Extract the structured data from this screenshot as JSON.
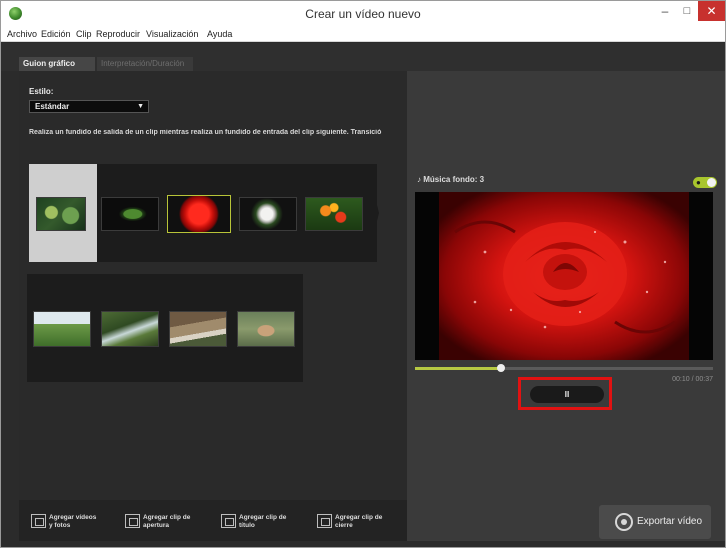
{
  "window": {
    "title": "Crear un vídeo nuevo",
    "minimize": "–",
    "maximize": "□",
    "close": "✕"
  },
  "menu": [
    "Archivo",
    "Edición",
    "Clip",
    "Reproducir",
    "Visualización",
    "Ayuda"
  ],
  "tabs": [
    "Guion gráfico",
    "Interpretación/Duración"
  ],
  "style": {
    "label": "Estilo:",
    "value": "Estándar"
  },
  "transition_description": "Realiza un fundido de salida de un clip mientras realiza un fundido de entrada del clip siguiente. Transició",
  "clips_row1": [
    "empty-slot",
    "water-lilies",
    "green-plant",
    "red-rose",
    "white-flower",
    "orange-flowers"
  ],
  "clips_row2": [
    "green-field",
    "waterfall-stream",
    "thatched-house",
    "ducks-on-water"
  ],
  "music": {
    "label": "♪ Música fondo: 3",
    "toggle": "on"
  },
  "preview": {
    "subject": "red-rose-with-water-drops"
  },
  "playback": {
    "progress": 0.29,
    "time": "00:10 / 00:37",
    "pause_symbol": "II"
  },
  "bottom_buttons": [
    {
      "label": "Agregar vídeos\ny fotos"
    },
    {
      "label": "Agregar clip de\napertura"
    },
    {
      "label": "Agregar clip de\ntítulo"
    },
    {
      "label": "Agregar clip de\ncierre"
    }
  ],
  "export": {
    "label": "Exportar vídeo"
  },
  "colors": {
    "accent_green": "#b7c943",
    "highlight_red": "#e21212",
    "close_red": "#c7312e"
  }
}
